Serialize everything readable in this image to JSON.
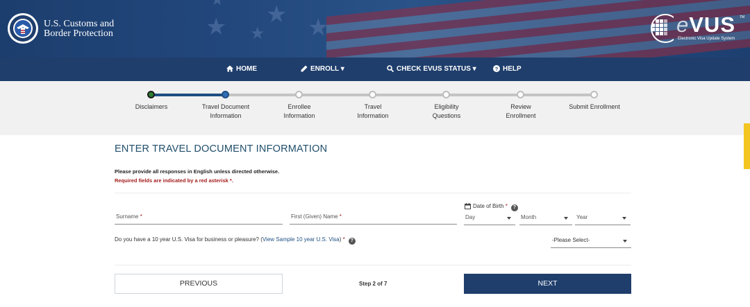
{
  "header": {
    "agency_line1": "U.S. Customs and",
    "agency_line2": "Border Protection",
    "logo_word": "VUS",
    "logo_e": "e",
    "logo_tm": "TM",
    "logo_subtitle": "Electronic Visa Update System"
  },
  "nav": {
    "items": [
      {
        "label": "HOME",
        "icon": "home-icon"
      },
      {
        "label": "ENROLL",
        "icon": "pencil-icon",
        "dropdown": true
      },
      {
        "label": "CHECK EVUS STATUS",
        "icon": "search-icon",
        "dropdown": true
      },
      {
        "label": "HELP",
        "icon": "question-circle-icon"
      }
    ]
  },
  "stepper": {
    "current_step": 2,
    "steps": [
      {
        "line1": "Disclaimers",
        "line2": "",
        "state": "done"
      },
      {
        "line1": "Travel Document",
        "line2": "Information",
        "state": "current"
      },
      {
        "line1": "Enrollee",
        "line2": "Information",
        "state": "upcoming"
      },
      {
        "line1": "Travel",
        "line2": "Information",
        "state": "upcoming"
      },
      {
        "line1": "Eligibility",
        "line2": "Questions",
        "state": "upcoming"
      },
      {
        "line1": "Review",
        "line2": "Enrollment",
        "state": "upcoming"
      },
      {
        "line1": "Submit Enrollment",
        "line2": "",
        "state": "upcoming"
      }
    ]
  },
  "form": {
    "title": "ENTER TRAVEL DOCUMENT INFORMATION",
    "instruction": "Please provide all responses in English unless directed otherwise.",
    "required_note": "Required fields are indicated by a red asterisk",
    "required_mark": "*",
    "surname_placeholder": "Surname",
    "given_name_placeholder": "First (Given) Name",
    "dob_label": "Date of Birth",
    "dob_day": "Day",
    "dob_month": "Month",
    "dob_year": "Year",
    "visa_question_prefix": "Do you have a 10 year U.S. Visa for business or pleasure? (",
    "visa_question_link": "View Sample 10 year U.S. Visa",
    "visa_question_suffix": ")",
    "visa_select_value": "-Please Select-"
  },
  "footer": {
    "previous_label": "PREVIOUS",
    "step_indicator": "Step 2 of 7",
    "next_label": "NEXT"
  },
  "colors": {
    "header_bg": "#22477c",
    "nav_bg": "#1f3e6c",
    "stepper_bg": "#f1f1f1",
    "progress_done": "#1f4e82",
    "required_red": "#a41c1c",
    "title_teal": "#1f4e6b",
    "feedback_tab": "#f3c520"
  }
}
